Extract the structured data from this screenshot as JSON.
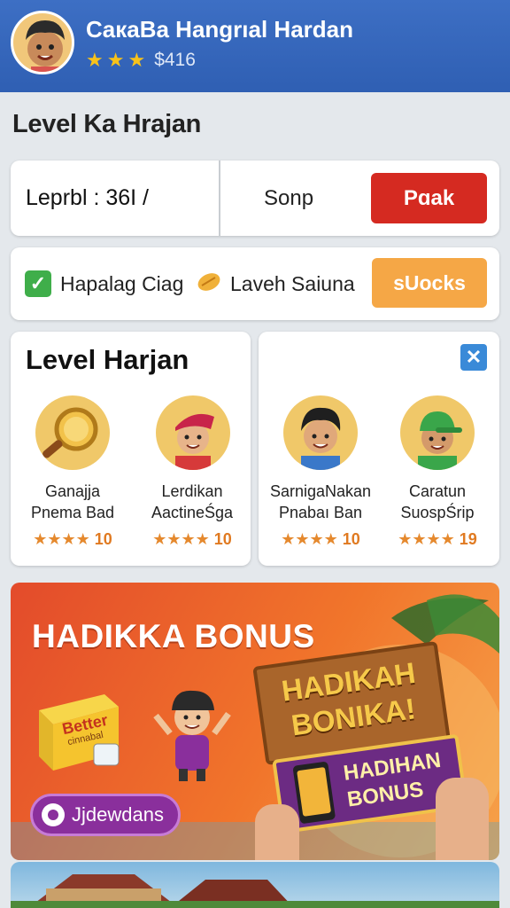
{
  "header": {
    "title": "CaкaBa Hangrıal Hardan",
    "stars": 3,
    "coins": "$416"
  },
  "section_title": "Level Ka Hrajan",
  "row1": {
    "level_field": "Leprbl : 36I /",
    "song_label": "Sonp",
    "button_label": "Pɑak"
  },
  "row2": {
    "check_label": "Hapalag Ciag",
    "egg_label": "Laveh Saiuna",
    "button_label": "sUocks"
  },
  "panel_left": {
    "title": "Level Harjan",
    "characters": [
      {
        "name1": "Ganajja",
        "name2": "Pnema Bad",
        "stars": 4,
        "rating": "10",
        "icon": "magnifier-icon"
      },
      {
        "name1": "Lerdikan",
        "name2": "AactineŚga",
        "stars": 4,
        "rating": "10",
        "icon": "character-red-hat-icon"
      }
    ]
  },
  "panel_right": {
    "characters": [
      {
        "name1": "SarnigaNakan",
        "name2": "Pnabaı Ban",
        "stars": 4,
        "rating": "10",
        "icon": "character-dark-hair-icon"
      },
      {
        "name1": "Caratun",
        "name2": "SuospŚrip",
        "stars": 4,
        "rating": "19",
        "icon": "character-green-cap-icon"
      }
    ]
  },
  "bonus": {
    "title": "HADIKKA BONUS",
    "box_text1": "Better",
    "box_text2": "cinnabal",
    "button_label": "Jjdewdans",
    "sign1_line1": "HADIKAH",
    "sign1_line2": "BONIKA!",
    "sign2_line1": "HADIHAN",
    "sign2_line2": "BONUS"
  },
  "colors": {
    "header": "#2f5fb3",
    "red_button": "#d52a21",
    "orange_button": "#f5a746",
    "star": "#e5892e"
  }
}
